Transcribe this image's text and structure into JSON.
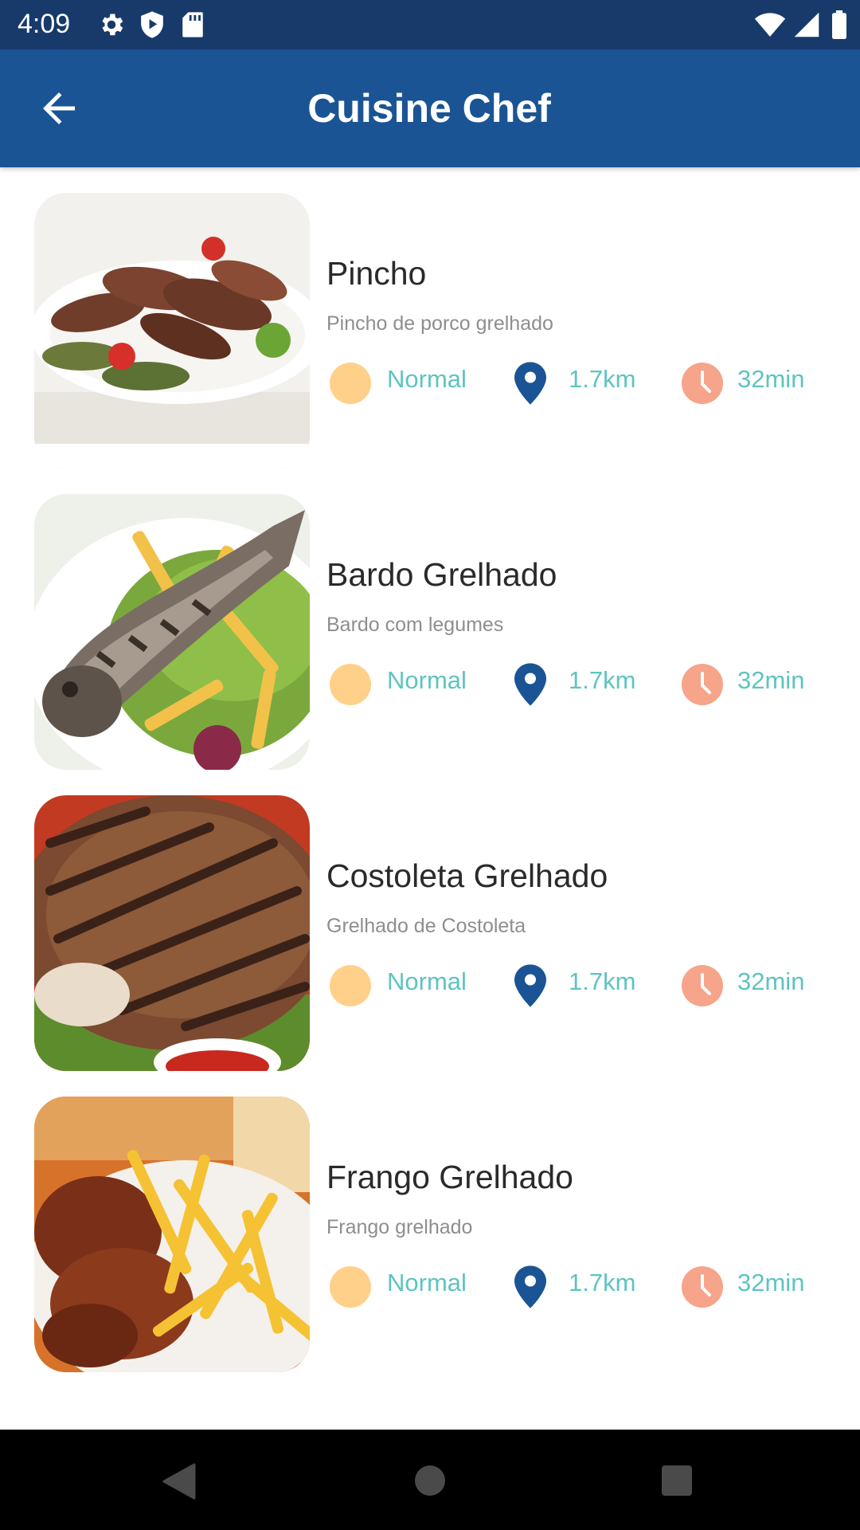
{
  "status_bar": {
    "time": "4:09",
    "left_icons": [
      "settings-icon",
      "play-protect-icon",
      "sd-card-icon"
    ],
    "right_icons": [
      "wifi-icon",
      "signal-icon",
      "battery-icon"
    ]
  },
  "app_bar": {
    "title": "Cuisine Chef",
    "back_icon": "arrow-left-icon",
    "background": "#1a5494"
  },
  "dishes": [
    {
      "name": "Pincho",
      "description": "Pincho de porco grelhado",
      "difficulty": "Normal",
      "distance": "1.7km",
      "time": "32min",
      "image": "grilled-pork-skewers-photo"
    },
    {
      "name": "Bardo Grelhado",
      "description": "Bardo com legumes",
      "difficulty": "Normal",
      "distance": "1.7km",
      "time": "32min",
      "image": "grilled-fish-photo"
    },
    {
      "name": "Costoleta Grelhado",
      "description": "Grelhado de Costoleta",
      "difficulty": "Normal",
      "distance": "1.7km",
      "time": "32min",
      "image": "grilled-chop-photo"
    },
    {
      "name": "Frango Grelhado",
      "description": "Frango grelhado",
      "difficulty": "Normal",
      "distance": "1.7km",
      "time": "32min",
      "image": "grilled-chicken-fries-photo"
    }
  ],
  "colors": {
    "meta_text": "#5ec4c0",
    "difficulty_dot": "#ffd08a",
    "location_pin": "#1a5494",
    "clock": "#f6a48a"
  },
  "nav_bar": {
    "buttons": [
      "back-triangle-icon",
      "home-circle-icon",
      "recents-square-icon"
    ]
  }
}
